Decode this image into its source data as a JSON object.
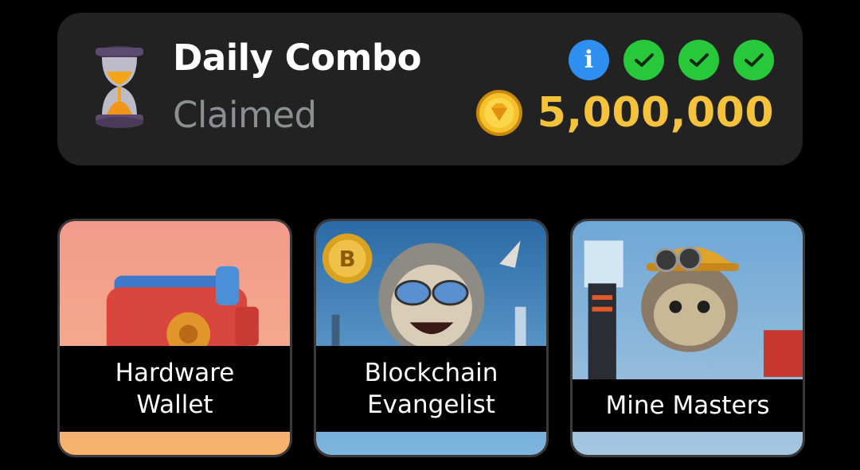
{
  "daily_combo": {
    "title": "Daily Combo",
    "status": "Claimed",
    "reward": "5,000,000",
    "info_icon_glyph": "i",
    "indicators": [
      "info-icon",
      "check-icon",
      "check-icon",
      "check-icon"
    ],
    "colors": {
      "panel": "#222223",
      "reward": "#f5c33b",
      "info": "#2f8ff0",
      "check": "#27c93b",
      "status": "#8d8e92"
    }
  },
  "cards": [
    {
      "label_line1": "Hardware",
      "label_line2": "Wallet",
      "image": "wallet-image"
    },
    {
      "label_line1": "Blockchain",
      "label_line2": "Evangelist",
      "image": "sloth-sunglasses-image"
    },
    {
      "label_line1": "Mine Masters",
      "image": "sloth-miner-image"
    }
  ]
}
